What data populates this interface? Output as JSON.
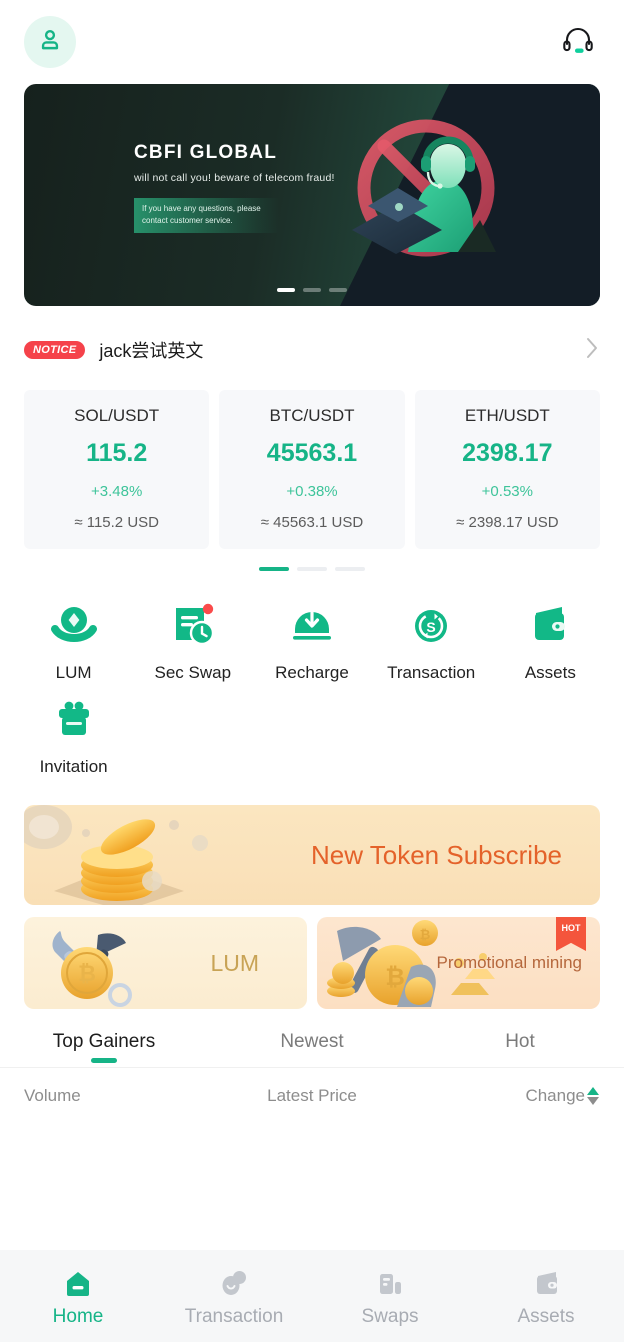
{
  "colors": {
    "brand_green": "#16b487",
    "notice_red": "#f5424a",
    "hot_orange": "#f4553c",
    "promo_text_orange": "#e4622a",
    "nav_inactive": "#a8acb3"
  },
  "header": {
    "avatar_icon": "user-avatar-icon",
    "support_icon": "headset-support-icon"
  },
  "banner": {
    "title": "CBFI  GLOBAL",
    "subtitle": "will not call you!   beware of telecom fraud!",
    "pill_line1": "If you have any questions, please",
    "pill_line2": "contact customer service.",
    "illustration": "customer-service-agent-no-call-illustration",
    "slides": [
      {
        "active": true
      },
      {
        "active": false
      },
      {
        "active": false
      }
    ]
  },
  "notice": {
    "badge": "NOTICE",
    "text": "jack尝试英文",
    "chevron": "chevron-right-icon"
  },
  "price_cards": {
    "items": [
      {
        "pair": "SOL/USDT",
        "price": "115.2",
        "change": "+3.48%",
        "usd": "≈ 115.2 USD"
      },
      {
        "pair": "BTC/USDT",
        "price": "45563.1",
        "change": "+0.38%",
        "usd": "≈ 45563.1 USD"
      },
      {
        "pair": "ETH/USDT",
        "price": "2398.17",
        "change": "+0.53%",
        "usd": "≈ 2398.17 USD"
      }
    ],
    "pagination": [
      {
        "active": true
      },
      {
        "active": false
      },
      {
        "active": false
      }
    ]
  },
  "quick_actions": {
    "items": [
      {
        "label": "LUM",
        "icon": "hand-holding-coin-icon",
        "badge": false
      },
      {
        "label": "Sec Swap",
        "icon": "document-clock-icon",
        "badge": true
      },
      {
        "label": "Recharge",
        "icon": "download-deposit-icon",
        "badge": false
      },
      {
        "label": "Transaction",
        "icon": "swap-dollar-circle-icon",
        "badge": false
      },
      {
        "label": "Assets",
        "icon": "wallet-icon",
        "badge": false
      },
      {
        "label": "Invitation",
        "icon": "gift-box-icon",
        "badge": false
      }
    ]
  },
  "promos": {
    "main": {
      "label": "New Token Subscribe",
      "illustration": "gold-coin-stack-illustration"
    },
    "small": [
      {
        "label": "LUM",
        "illustration": "shovel-pickaxe-bitcoin-illustration",
        "hot": false
      },
      {
        "label": "Promotional mining",
        "illustration": "pickaxe-coins-gold-bars-illustration",
        "hot": true,
        "hot_label": "HOT"
      }
    ]
  },
  "market": {
    "tabs": [
      {
        "label": "Top Gainers",
        "active": true
      },
      {
        "label": "Newest",
        "active": false
      },
      {
        "label": "Hot",
        "active": false
      }
    ],
    "columns": {
      "volume": "Volume",
      "latest_price": "Latest Price",
      "change": "Change"
    },
    "sort": {
      "ascending_active": true,
      "descending_active": false
    }
  },
  "bottom_nav": {
    "items": [
      {
        "label": "Home",
        "icon": "home-icon",
        "active": true
      },
      {
        "label": "Transaction",
        "icon": "transaction-bubbles-icon",
        "active": false
      },
      {
        "label": "Swaps",
        "icon": "swaps-chart-icon",
        "active": false
      },
      {
        "label": "Assets",
        "icon": "wallet-nav-icon",
        "active": false
      }
    ]
  }
}
